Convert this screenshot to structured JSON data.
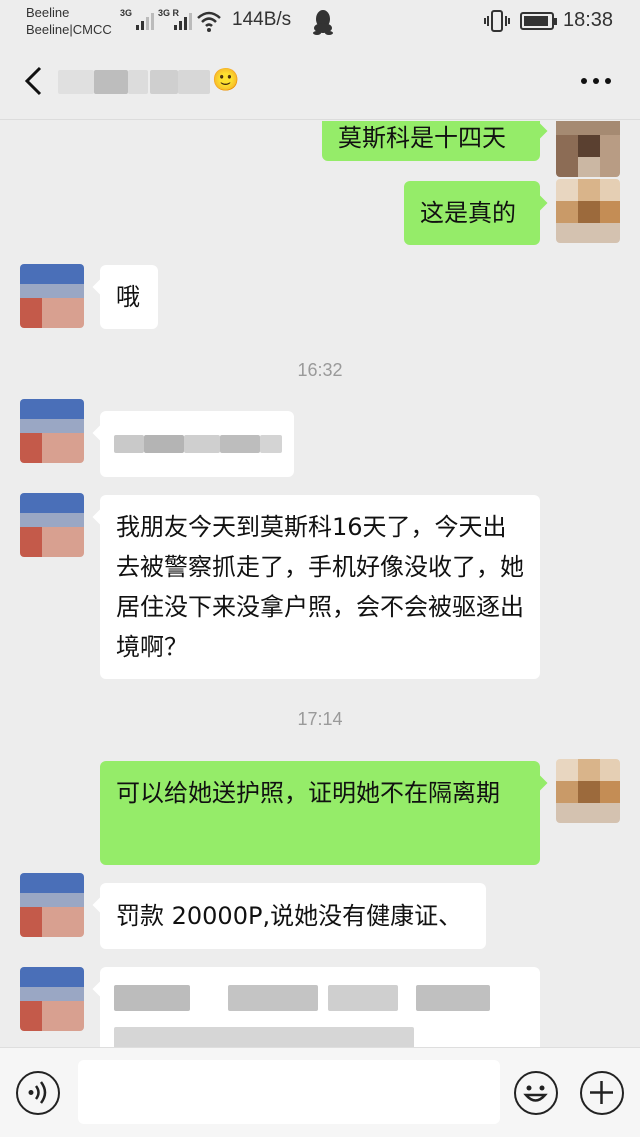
{
  "status_bar": {
    "carrier_line1": "Beeline",
    "carrier_line2": "Beeline|CMCC",
    "signal1_label": "3G",
    "signal2_label": "3G R",
    "net_speed": "144B/s",
    "time": "18:38",
    "battery_level_percent": 80
  },
  "nav": {
    "back_icon": "chevron-left-icon",
    "more_icon": "more-dots-icon",
    "title_emoji": "🙂"
  },
  "messages": [
    {
      "side": "out",
      "text": "莫斯科是十四天"
    },
    {
      "side": "out",
      "text": "这是真的"
    },
    {
      "side": "in",
      "text": "哦"
    },
    {
      "side": "in",
      "text": ""
    },
    {
      "side": "in",
      "text": "我朋友今天到莫斯科16天了，今天出去被警察抓走了，手机好像没收了，她居住没下来没拿户照，会不会被驱逐出境啊？"
    },
    {
      "side": "out",
      "text": "可以给她送护照，证明她不在隔离期"
    },
    {
      "side": "in",
      "text": "罚款 20000P,说她没有健康证、"
    },
    {
      "side": "in",
      "text": ""
    }
  ],
  "timestamps": [
    "16:32",
    "17:14"
  ],
  "input_bar": {
    "voice_icon": "voice-icon",
    "emoji_icon": "emoji-icon",
    "plus_icon": "plus-icon",
    "text_value": ""
  },
  "colors": {
    "background": "#ededed",
    "bubble_out": "#95ec69",
    "bubble_in": "#ffffff"
  }
}
